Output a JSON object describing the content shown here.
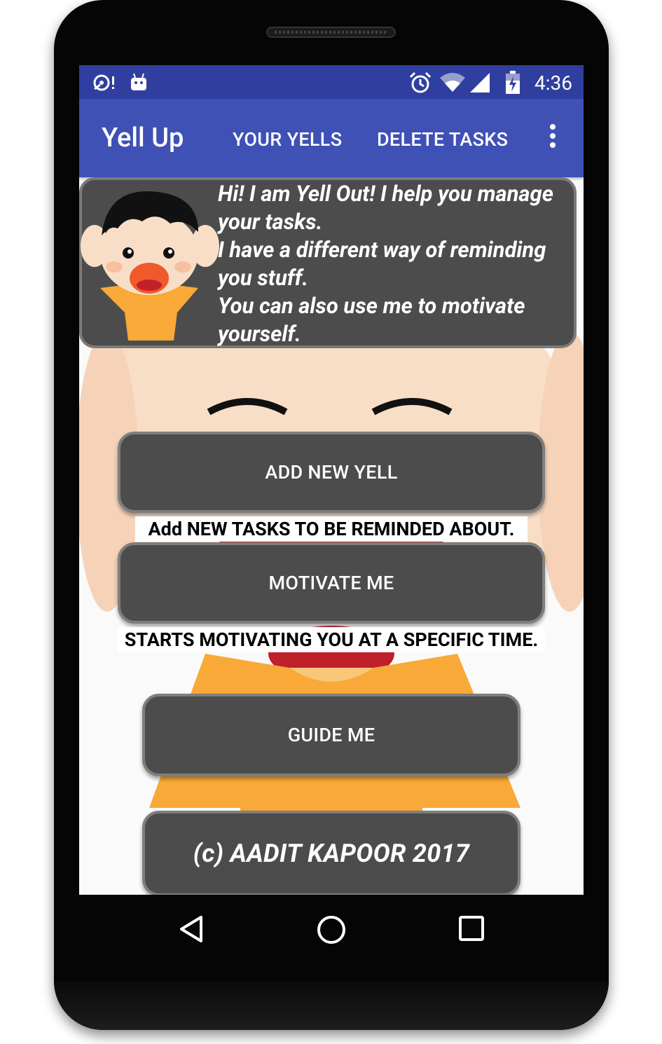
{
  "status_bar": {
    "time": "4:36",
    "left_icons": [
      "sync-alert-icon",
      "android-icon"
    ],
    "right_icons": [
      "alarm-icon",
      "wifi-icon",
      "signal-icon",
      "battery-charging-icon"
    ]
  },
  "app_bar": {
    "title": "Yell Up",
    "actions": [
      "YOUR YELLS",
      "DELETE TASKS"
    ],
    "overflow_icon": "more-vert-icon"
  },
  "intro": {
    "text": "Hi! I am Yell Out! I help you manage your tasks.\nI have a different way of reminding you stuff.\nYou can also use me to motivate yourself."
  },
  "buttons": {
    "add_new_yell": "ADD NEW YELL",
    "motivate_me": "MOTIVATE ME",
    "guide_me": "GUIDE ME",
    "copyright": "(c) AADIT KAPOOR 2017"
  },
  "captions": {
    "add_new_yell": "Add NEW TASKS TO BE REMINDED ABOUT.",
    "motivate_me": "STARTS MOTIVATING YOU AT A SPECIFIC TIME."
  },
  "nav_bar": {
    "icons": [
      "back-icon",
      "home-icon",
      "recents-icon"
    ]
  },
  "colors": {
    "status_bar": "#303f9f",
    "app_bar": "#3f51b5",
    "button": "#4c4c4c",
    "button_border": "#7e7e7e",
    "shirt": "#f9a937",
    "skin": "#f9dec7"
  }
}
